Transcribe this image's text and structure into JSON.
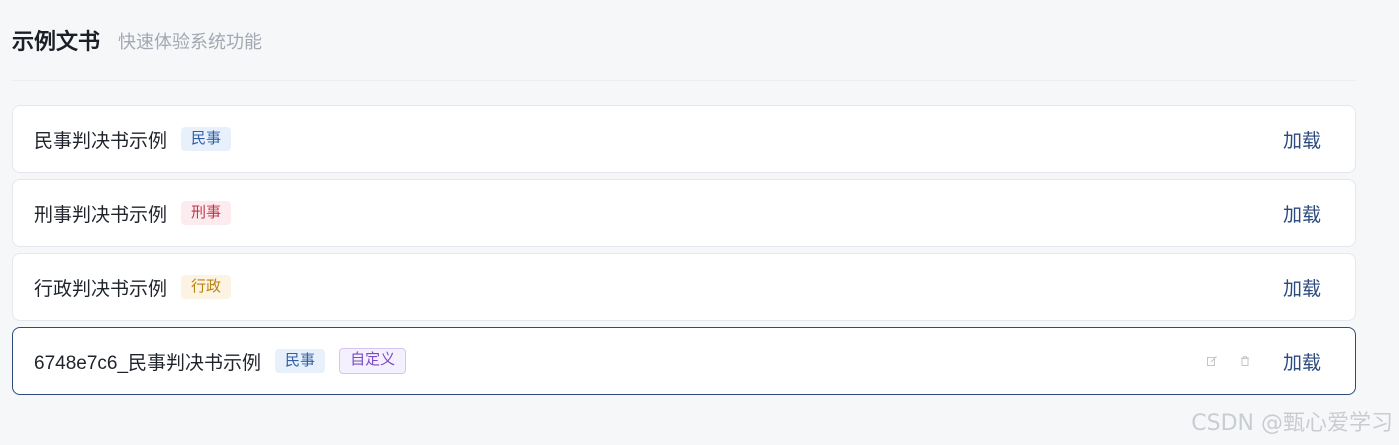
{
  "header": {
    "title": "示例文书",
    "subtitle": "快速体验系统功能"
  },
  "docs": [
    {
      "name": "民事判决书示例",
      "tag": "民事",
      "load_label": "加载"
    },
    {
      "name": "刑事判决书示例",
      "tag": "刑事",
      "load_label": "加载"
    },
    {
      "name": "行政判决书示例",
      "tag": "行政",
      "load_label": "加载"
    },
    {
      "name": "6748e7c6_民事判决书示例",
      "tag": "民事",
      "custom_tag": "自定义",
      "load_label": "加载"
    }
  ],
  "icons": {
    "edit": "edit-icon",
    "delete": "trash-icon"
  },
  "watermark": "CSDN @甄心爱学习",
  "colors": {
    "accent": "#2b4a7e",
    "active_border": "#2c4a7c"
  }
}
